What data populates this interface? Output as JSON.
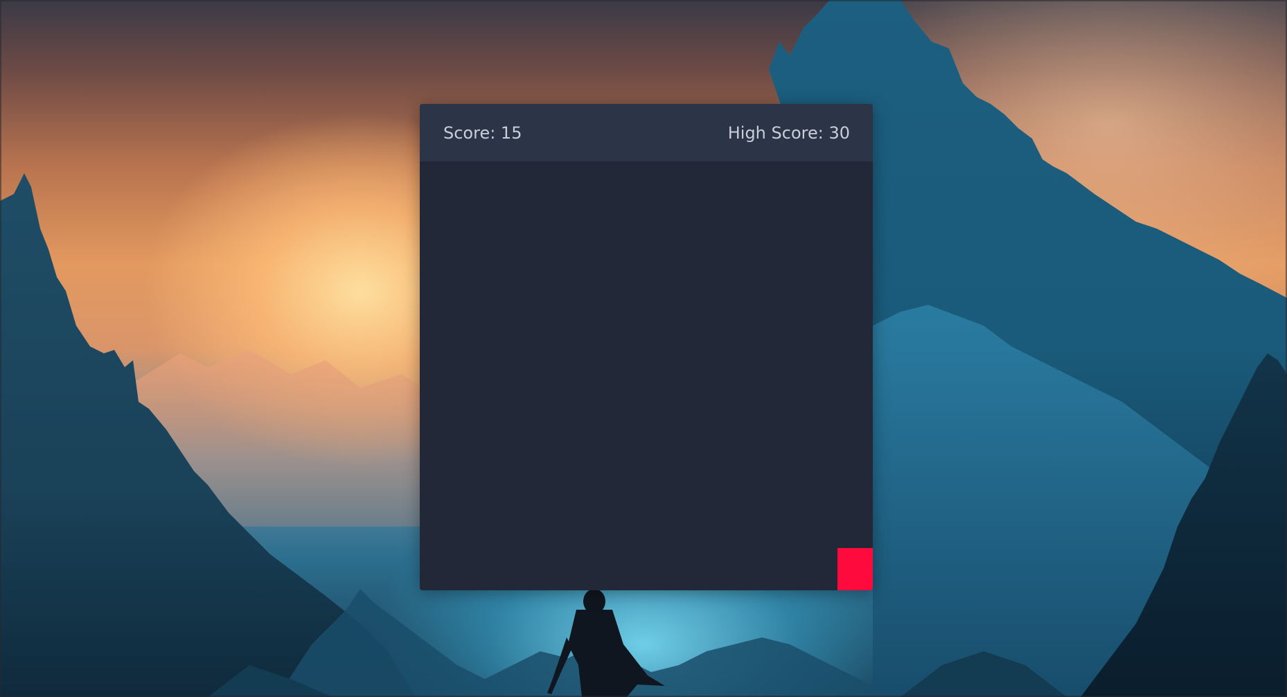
{
  "scoreboard": {
    "score_label": "Score: 15",
    "high_score_label": "High Score: 30"
  },
  "board": {
    "background_color": "#232838",
    "block_color": "#ff0a3c"
  },
  "backdrop": {
    "description_icon": "mountain-landscape-wallpaper"
  }
}
